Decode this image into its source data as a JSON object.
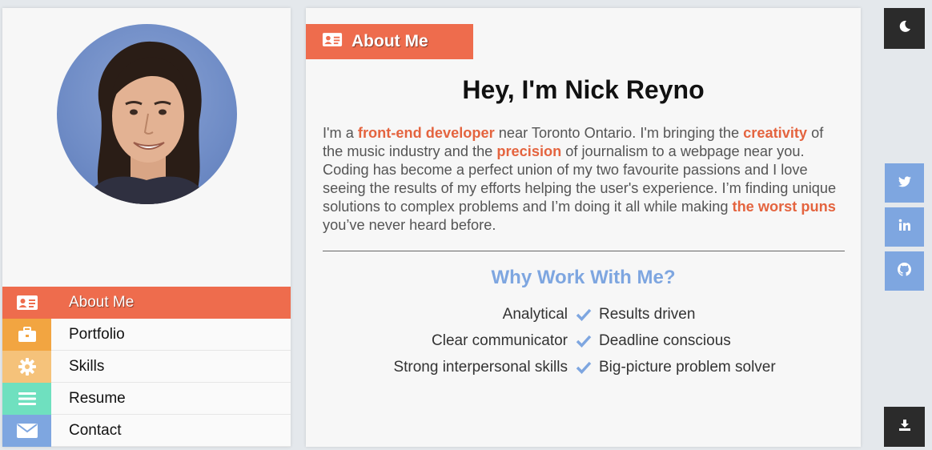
{
  "sidebar": {
    "nav": [
      {
        "label": "About Me",
        "icon": "id-card-icon",
        "color": "#ee6c4d",
        "active": true
      },
      {
        "label": "Portfolio",
        "icon": "briefcase-icon",
        "color": "#f2a541"
      },
      {
        "label": "Skills",
        "icon": "gear-icon",
        "color": "#f5c27a"
      },
      {
        "label": "Resume",
        "icon": "list-icon",
        "color": "#6fe0bf"
      },
      {
        "label": "Contact",
        "icon": "envelope-icon",
        "color": "#7ea6e0"
      }
    ]
  },
  "main": {
    "tab_label": "About Me",
    "greeting": "Hey, I'm Nick Reyno",
    "bio": {
      "p1": "I'm a ",
      "h1": "front-end developer",
      "p2": " near Toronto Ontario. I'm bringing the ",
      "h2": "creativity",
      "p3": " of the music industry and the ",
      "h3": "precision",
      "p4": " of journalism to a webpage near you. Coding has become a perfect union of my two favourite passions and I love seeing the results of my efforts helping the user's experience. I’m finding unique solutions to complex problems and I’m doing it all while making ",
      "h4": "the worst puns",
      "p5": " you’ve never heard before."
    },
    "why_heading": "Why Work With Me?",
    "traits": [
      {
        "left": "Analytical",
        "right": "Results driven"
      },
      {
        "left": "Clear communicator",
        "right": "Deadline conscious"
      },
      {
        "left": "Strong interpersonal skills",
        "right": "Big-picture problem solver"
      }
    ]
  },
  "right_bar": {
    "theme_toggle_icon": "moon-icon",
    "social": [
      {
        "icon": "twitter-icon",
        "glyph": "🐦"
      },
      {
        "icon": "linkedin-icon",
        "glyph": "in"
      },
      {
        "icon": "github-icon",
        "glyph": "gh"
      }
    ],
    "download_icon": "download-icon"
  },
  "colors": {
    "accent": "#ee6c4d",
    "highlight_text": "#e4643f",
    "blue": "#7ea6e0",
    "dark": "#2b2b2b"
  }
}
